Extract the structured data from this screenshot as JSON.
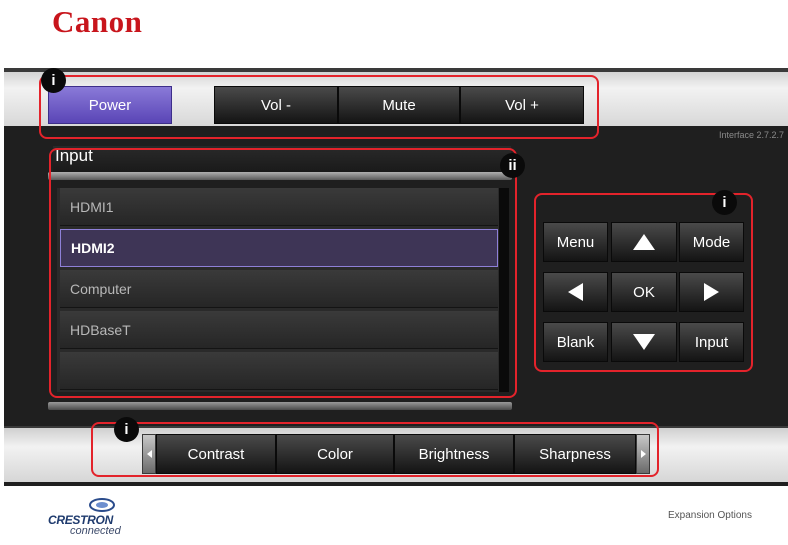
{
  "brand": {
    "logo_text": "Canon",
    "color": "#c8151c"
  },
  "interface_version": "Interface 2.7.2.7",
  "power_bar": {
    "power": "Power",
    "vol_minus": "Vol -",
    "mute": "Mute",
    "vol_plus": "Vol +"
  },
  "input_panel": {
    "title": "Input",
    "items": [
      {
        "label": "HDMI1",
        "selected": false
      },
      {
        "label": "HDMI2",
        "selected": true
      },
      {
        "label": "Computer",
        "selected": false
      },
      {
        "label": "HDBaseT",
        "selected": false
      },
      {
        "label": "",
        "selected": false
      }
    ]
  },
  "nav_pad": {
    "menu": "Menu",
    "mode": "Mode",
    "ok": "OK",
    "blank": "Blank",
    "input": "Input"
  },
  "picture_bar": {
    "contrast": "Contrast",
    "color": "Color",
    "brightness": "Brightness",
    "sharpness": "Sharpness"
  },
  "markers": {
    "power_bar": "i",
    "input_list": "ii",
    "nav_pad": "i",
    "picture_bar": "i"
  },
  "footer": {
    "crestron_logo": "CRESTRON",
    "crestron_sub": "connected",
    "expansion": "Expansion Options"
  },
  "colors": {
    "accent": "#6b58c8",
    "callout": "#e3232b",
    "panel_bg": "#1f1f1f",
    "selected_item": "#3e3556"
  },
  "icons": [
    "triangle-up-icon",
    "triangle-down-icon",
    "triangle-left-icon",
    "triangle-right-icon",
    "scroll-left-icon",
    "scroll-right-icon"
  ]
}
